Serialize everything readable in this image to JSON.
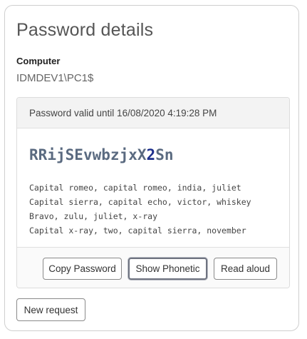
{
  "page": {
    "title": "Password details"
  },
  "computer": {
    "label": "Computer",
    "value": "IDMDEV1\\PC1$"
  },
  "password_card": {
    "validity": "Password valid until 16/08/2020 4:19:28 PM",
    "password_chars": [
      {
        "ch": "R",
        "type": "letter"
      },
      {
        "ch": "R",
        "type": "letter"
      },
      {
        "ch": "i",
        "type": "letter"
      },
      {
        "ch": "j",
        "type": "letter"
      },
      {
        "ch": "S",
        "type": "letter"
      },
      {
        "ch": "E",
        "type": "letter"
      },
      {
        "ch": "v",
        "type": "letter"
      },
      {
        "ch": "w",
        "type": "letter"
      },
      {
        "ch": "b",
        "type": "letter"
      },
      {
        "ch": "z",
        "type": "letter"
      },
      {
        "ch": "j",
        "type": "letter"
      },
      {
        "ch": "x",
        "type": "letter"
      },
      {
        "ch": "X",
        "type": "letter"
      },
      {
        "ch": "2",
        "type": "digit"
      },
      {
        "ch": "S",
        "type": "letter"
      },
      {
        "ch": "n",
        "type": "letter"
      }
    ],
    "phonetic": [
      "Capital romeo, capital romeo, india, juliet",
      "Capital sierra, capital echo, victor, whiskey",
      "Bravo, zulu, juliet, x-ray",
      "Capital x-ray, two, capital sierra, november"
    ],
    "buttons": {
      "copy": "Copy Password",
      "phonetic": "Show Phonetic",
      "read": "Read aloud"
    }
  },
  "actions": {
    "new_request": "New request"
  },
  "colors": {
    "password_letter": "#5a6a80",
    "password_digit": "#1c2e8c"
  }
}
